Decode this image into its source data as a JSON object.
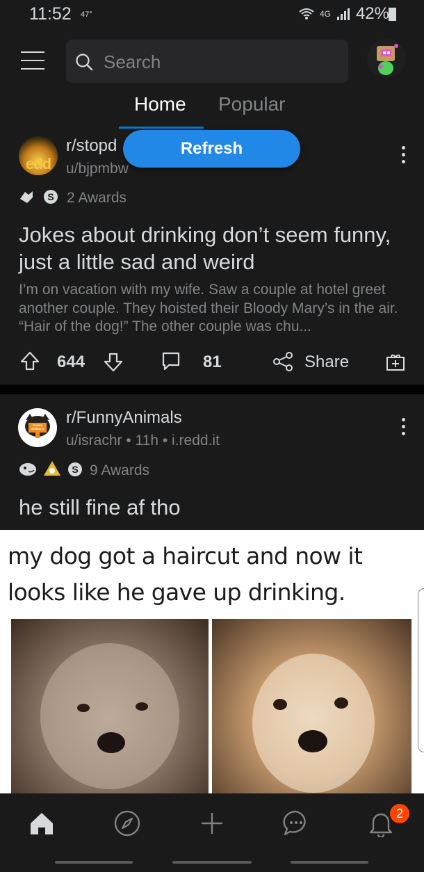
{
  "status_bar": {
    "time": "11:52",
    "temperature": "47°",
    "network": "4G",
    "battery": "42%"
  },
  "header": {
    "search_placeholder": "Search",
    "tabs": [
      {
        "label": "Home",
        "active": true
      },
      {
        "label": "Popular",
        "active": false
      }
    ]
  },
  "refresh_label": "Refresh",
  "posts": [
    {
      "subreddit": "r/stopd",
      "subreddit_icon_text": "edd",
      "author": "u/bjpmbw",
      "awards": "2 Awards",
      "title": "Jokes about drinking don’t seem funny, just a little sad and weird",
      "body": "I’m on vacation with my wife. Saw a couple at hotel greet another couple. They hoisted their Bloody  Mary’s in the air. “Hair of the dog!” The other couple was chu...",
      "upvotes": "644",
      "comments": "81",
      "share_label": "Share"
    },
    {
      "subreddit": "r/FunnyAnimals",
      "subreddit_icon_text": "FUNNY ANIMALS",
      "meta": "u/israchr • 11h • i.redd.it",
      "awards": "9 Awards",
      "title": "he still fine af tho",
      "image_caption": "my dog got a haircut and now it looks like he gave up drinking."
    }
  ],
  "bottom_nav": {
    "items": [
      "home-icon",
      "explore-icon",
      "create-post-icon",
      "chat-icon",
      "notifications-icon"
    ],
    "notification_count": "2"
  },
  "colors": {
    "background": "#1a1a1b",
    "accent": "#0079d3",
    "refresh": "#2188e7",
    "badge": "#ff4500"
  }
}
